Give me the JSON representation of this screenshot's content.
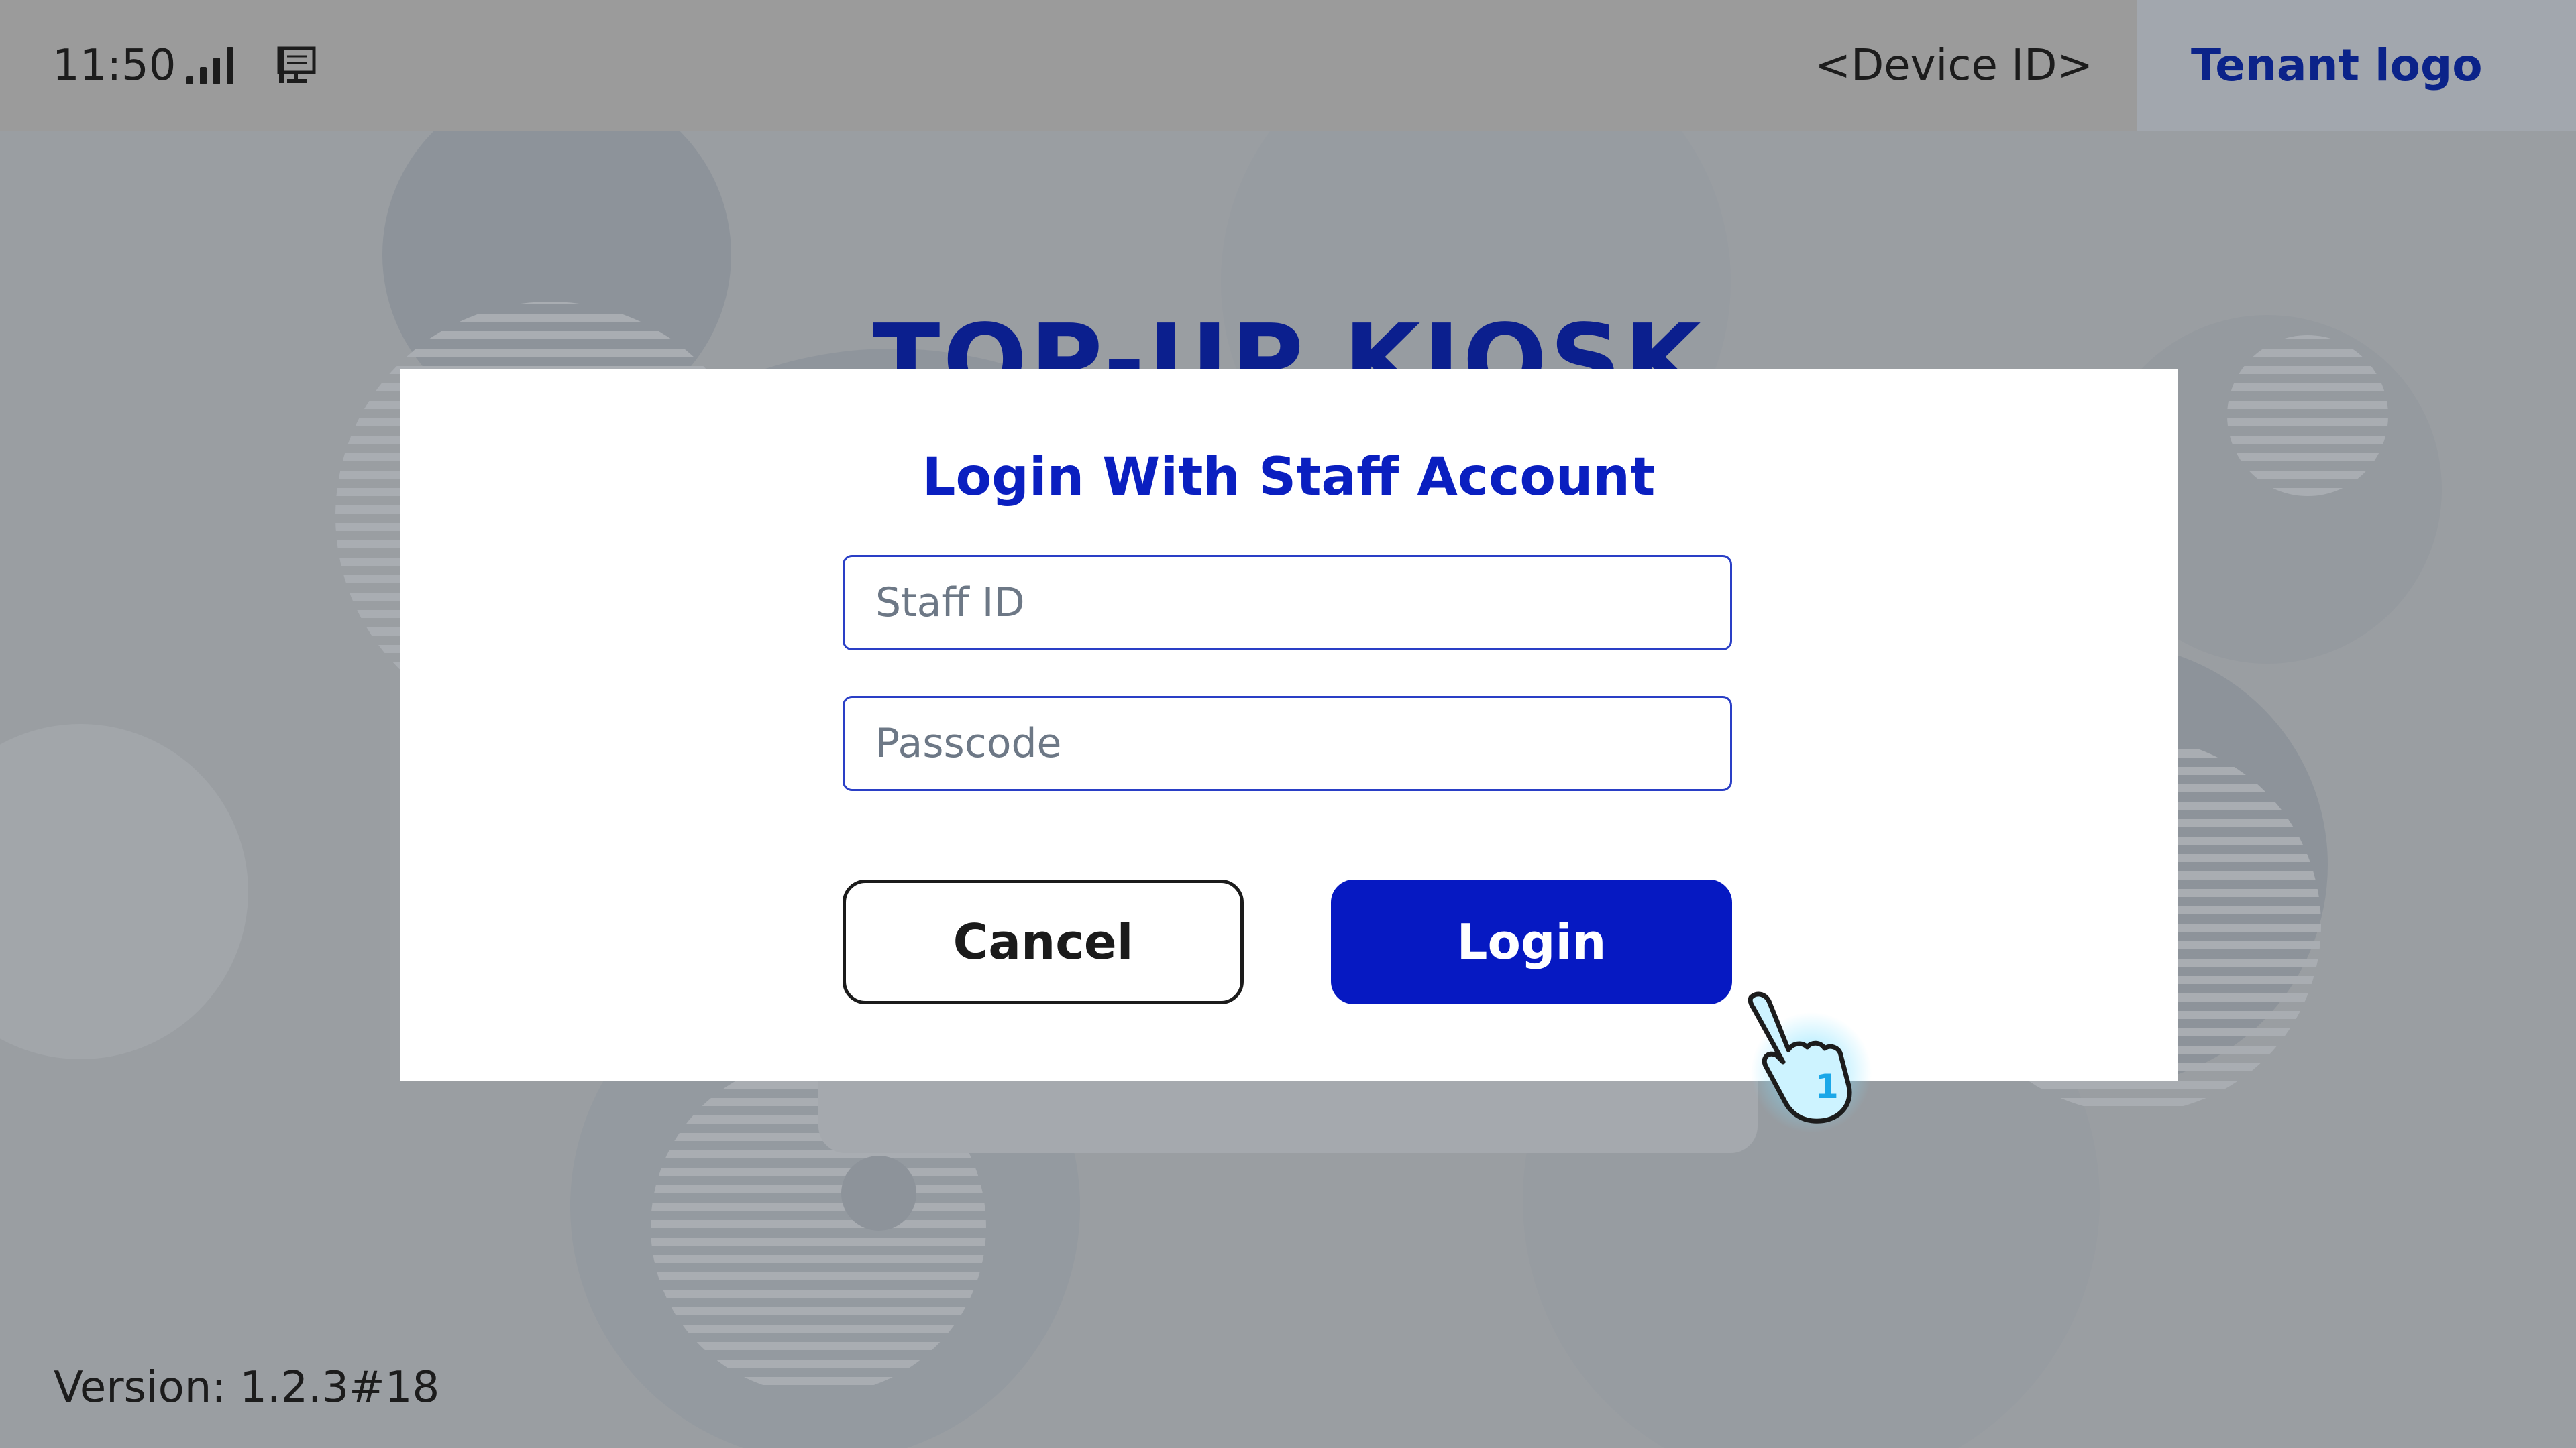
{
  "status_bar": {
    "time": "11:50",
    "icons": [
      "signal-strength-icon",
      "monitor-icon"
    ],
    "device_id": "<Device ID>",
    "tenant_logo": "Tenant logo"
  },
  "page": {
    "title": "TOP-UP KIOSK",
    "version": "Version: 1.2.3#18"
  },
  "login_modal": {
    "title": "Login With Staff Account",
    "staff_id": {
      "placeholder": "Staff ID",
      "value": ""
    },
    "passcode": {
      "placeholder": "Passcode",
      "value": ""
    },
    "cancel_label": "Cancel",
    "login_label": "Login"
  },
  "cursor": {
    "icon": "hand-pointer-icon",
    "badge": "1"
  },
  "colors": {
    "brand_blue": "#0619c2",
    "title_blue": "#0a1fc0",
    "logo_blue": "#0b2389",
    "overlay_gray": "#9a9ea2"
  }
}
